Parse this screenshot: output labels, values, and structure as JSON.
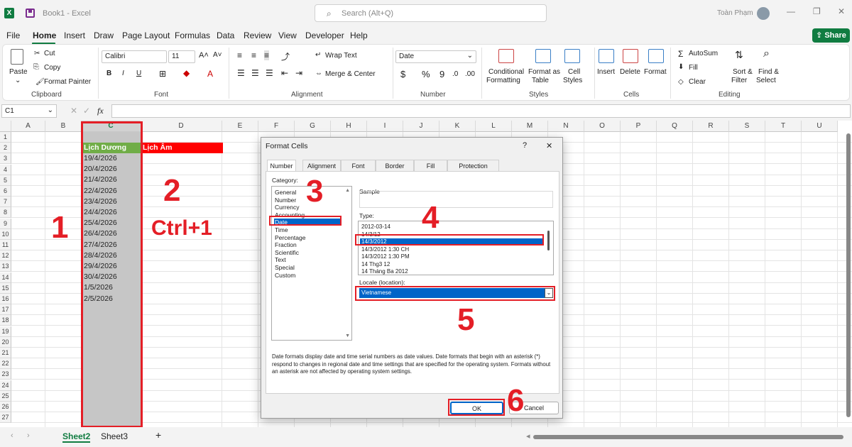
{
  "window": {
    "app_icon": "X",
    "title": "Book1  -  Excel",
    "search_placeholder": "Search (Alt+Q)",
    "user": "Toàn Phạm",
    "min": "—",
    "restore": "❐",
    "close": "✕"
  },
  "tabs": [
    "File",
    "Home",
    "Insert",
    "Draw",
    "Page Layout",
    "Formulas",
    "Data",
    "Review",
    "View",
    "Developer",
    "Help"
  ],
  "share_label": "Share",
  "ribbon": {
    "clipboard": {
      "paste": "Paste",
      "cut": "Cut",
      "copy": "Copy",
      "format_painter": "Format Painter",
      "label": "Clipboard"
    },
    "font": {
      "name": "Calibri",
      "size": "11",
      "label": "Font",
      "bold": "B",
      "italic": "I",
      "underline": "U"
    },
    "alignment": {
      "wrap": "Wrap Text",
      "merge": "Merge & Center",
      "label": "Alignment"
    },
    "number": {
      "format": "Date",
      "label": "Number"
    },
    "styles": {
      "conditional": "Conditional",
      "conditional2": "Formatting",
      "format_as": "Format as",
      "format_as2": "Table",
      "cell": "Cell",
      "cell2": "Styles",
      "label": "Styles"
    },
    "cells": {
      "insert": "Insert",
      "delete": "Delete",
      "format": "Format",
      "label": "Cells"
    },
    "editing": {
      "autosum": "AutoSum",
      "fill": "Fill",
      "clear": "Clear",
      "sort": "Sort &",
      "sort2": "Filter",
      "find": "Find &",
      "find2": "Select",
      "label": "Editing"
    }
  },
  "formula_bar": {
    "name_box": "C1",
    "fx": "fx",
    "value": ""
  },
  "columns": [
    "A",
    "B",
    "C",
    "D",
    "E",
    "F",
    "G",
    "H",
    "I",
    "J",
    "K",
    "L",
    "M",
    "N",
    "O",
    "P",
    "Q",
    "R",
    "S",
    "T",
    "U"
  ],
  "rows": [
    "1",
    "2",
    "3",
    "4",
    "5",
    "6",
    "7",
    "8",
    "9",
    "10",
    "11",
    "12",
    "13",
    "14",
    "15",
    "16",
    "17",
    "18",
    "19",
    "20",
    "21",
    "22",
    "23",
    "24",
    "25",
    "26",
    "27"
  ],
  "sheet": {
    "c2": "Lịch Dương",
    "d2": "Lịch Âm",
    "dates": [
      "19/4/2026",
      "20/4/2026",
      "21/4/2026",
      "22/4/2026",
      "23/4/2026",
      "24/4/2026",
      "25/4/2026",
      "26/4/2026",
      "27/4/2026",
      "28/4/2026",
      "29/4/2026",
      "30/4/2026",
      "1/5/2026",
      "2/5/2026"
    ]
  },
  "dialog": {
    "title": "Format Cells",
    "help": "?",
    "close": "✕",
    "tabs": [
      "Number",
      "Alignment",
      "Font",
      "Border",
      "Fill",
      "Protection"
    ],
    "category_label": "Category:",
    "categories": [
      "General",
      "Number",
      "Currency",
      "Accounting",
      "Date",
      "Time",
      "Percentage",
      "Fraction",
      "Scientific",
      "Text",
      "Special",
      "Custom"
    ],
    "sample_label": "Sample",
    "type_label": "Type:",
    "types": [
      "2012-03-14",
      "14/3/12",
      "14/3/2012",
      "14/3/2012 1:30 CH",
      "14/3/2012 1:30 PM",
      "14 Thg3 12",
      "14 Tháng Ba 2012"
    ],
    "locale_label": "Locale (location):",
    "locale": "Vietnamese",
    "note": "Date formats display date and time serial numbers as date values.  Date formats that begin with an asterisk (*) respond to changes in regional date and time settings that are specified for the operating system. Formats without an asterisk are not affected by operating system settings.",
    "ok": "OK",
    "cancel": "Cancel"
  },
  "annotations": {
    "n1": "1",
    "n2": "2",
    "ctrl": "Ctrl+1",
    "n3": "3",
    "n4": "4",
    "n5": "5",
    "n6": "6"
  },
  "sheets": [
    "Sheet2",
    "Sheet3"
  ],
  "add_sheet": "+",
  "colors": {
    "accent": "#107c41",
    "annotation": "#e41e26",
    "selection": "#0064c8"
  }
}
